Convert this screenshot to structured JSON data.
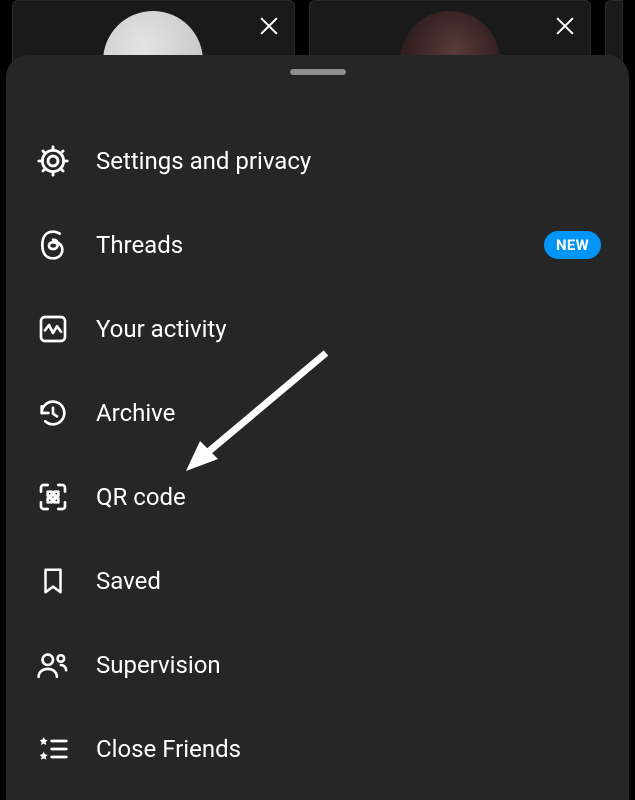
{
  "background": {
    "card_left": {
      "has_close": true
    },
    "card_right": {
      "has_close": true
    }
  },
  "sheet": {
    "handle": true
  },
  "menu": {
    "items": [
      {
        "key": "settings",
        "label": "Settings and privacy",
        "badge": null
      },
      {
        "key": "threads",
        "label": "Threads",
        "badge": "NEW"
      },
      {
        "key": "activity",
        "label": "Your activity",
        "badge": null
      },
      {
        "key": "archive",
        "label": "Archive",
        "badge": null
      },
      {
        "key": "qr",
        "label": "QR code",
        "badge": null
      },
      {
        "key": "saved",
        "label": "Saved",
        "badge": null
      },
      {
        "key": "supervision",
        "label": "Supervision",
        "badge": null
      },
      {
        "key": "close_friends",
        "label": "Close Friends",
        "badge": null
      }
    ]
  },
  "annotation": {
    "arrow_points_to": "archive"
  },
  "colors": {
    "sheet_bg": "#262626",
    "badge_bg": "#0095f6",
    "text": "#ffffff"
  }
}
